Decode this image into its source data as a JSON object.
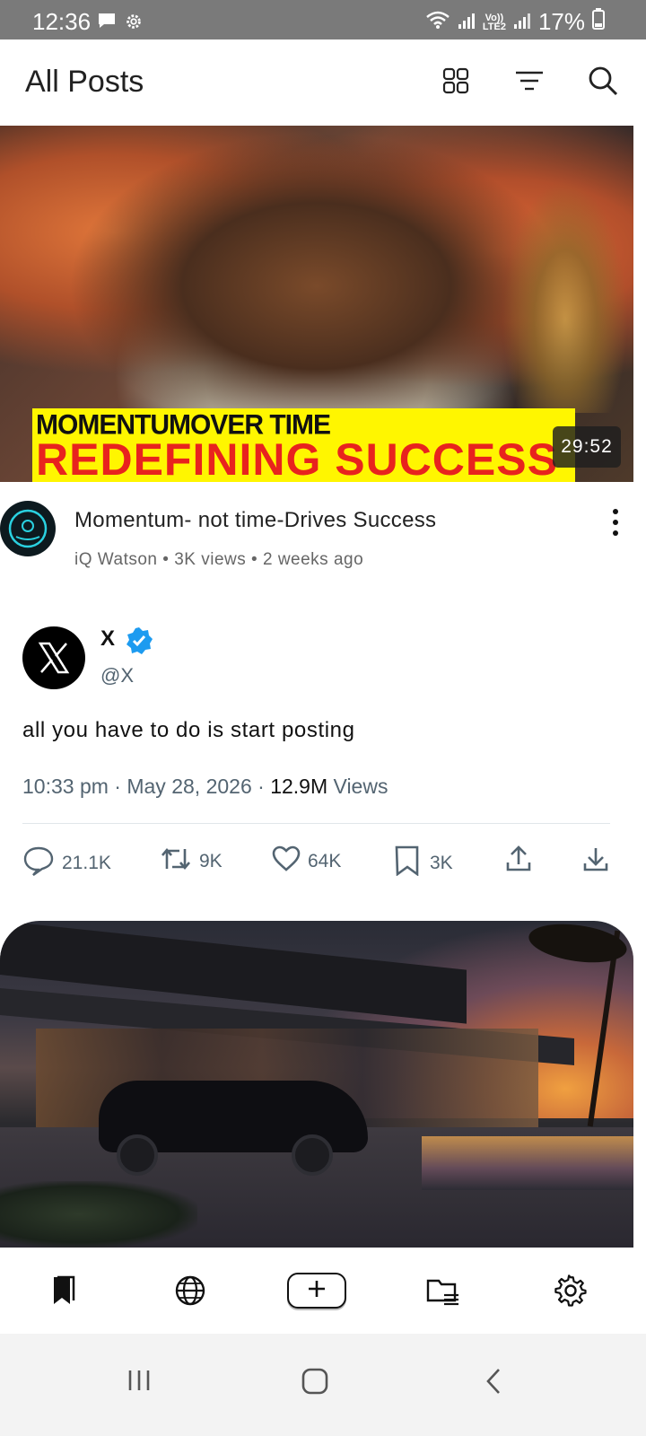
{
  "status_bar": {
    "time": "12:36",
    "battery": "17%",
    "network_label_top": "Vo))",
    "network_label_bottom": "LTE2",
    "icons": [
      "chat-bubble-icon",
      "settings-gear-icon",
      "wifi-icon",
      "signal-icon",
      "signal-icon",
      "battery-icon"
    ]
  },
  "header": {
    "title": "All Posts",
    "icons": [
      "grid-view-icon",
      "filter-icon",
      "search-icon"
    ]
  },
  "video_post": {
    "banner_top": "MOMENTUMOVER TIME",
    "banner_main": "REDEFINING SUCCESS",
    "duration": "29:52",
    "title": "Momentum- not time-Drives Success",
    "channel": "iQ Watson",
    "views": "3K  views",
    "age": "2 weeks ago",
    "separator": "•"
  },
  "x_post": {
    "name": "X",
    "handle": "@X",
    "text": "all you have to do is start posting",
    "time": "10:33 pm",
    "date": "May 28, 2026",
    "views_count": "12.9M",
    "views_label": "Views",
    "meta_sep": "·",
    "actions": {
      "replies": "21.1K",
      "reposts": "9K",
      "likes": "64K",
      "bookmarks": "3K"
    }
  },
  "bottom_nav": {
    "items": [
      "bookmarks-icon",
      "globe-icon",
      "add-icon",
      "folder-list-icon",
      "settings-icon"
    ]
  },
  "colors": {
    "status_bar_bg": "#7a7a7a",
    "verified_blue": "#1d9bf0",
    "banner_yellow": "#fff600",
    "banner_red": "#e8231e",
    "muted_text": "#536471"
  }
}
